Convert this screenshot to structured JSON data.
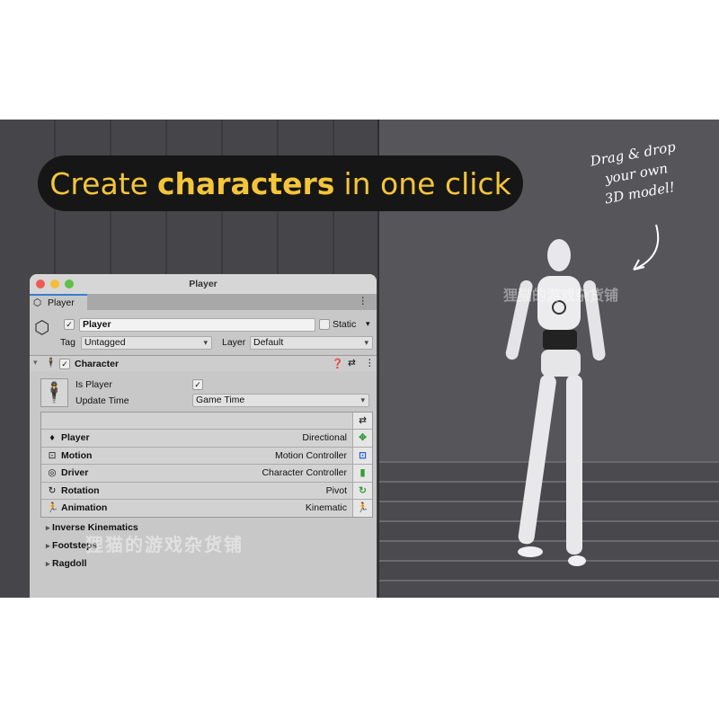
{
  "banner": {
    "prefix": "Create",
    "bold": "characters",
    "suffix": "in one click"
  },
  "annotation": {
    "line1": "Drag & drop",
    "line2": "your own",
    "line3": "3D model!"
  },
  "watermark": "狸猫的游戏杂货铺",
  "window": {
    "title": "Player",
    "tab": "Player",
    "object": {
      "name": "Player",
      "active": true,
      "static_label": "Static",
      "static": false,
      "tag_label": "Tag",
      "tag": "Untagged",
      "layer_label": "Layer",
      "layer": "Default"
    },
    "component": {
      "name": "Character",
      "enabled": true,
      "is_player_label": "Is Player",
      "is_player": true,
      "update_time_label": "Update Time",
      "update_time": "Game Time"
    },
    "kernel": [
      {
        "icon": "diamond-icon",
        "icon_char": "♦",
        "name": "Player",
        "value": "Directional",
        "right_icon_char": "✥",
        "color": "#3a9a3a"
      },
      {
        "icon": "chip-icon",
        "icon_char": "⊡",
        "name": "Motion",
        "value": "Motion Controller",
        "right_icon_char": "⊡",
        "color": "#2a66d0"
      },
      {
        "icon": "wheel-icon",
        "icon_char": "◎",
        "name": "Driver",
        "value": "Character Controller",
        "right_icon_char": "▮",
        "color": "#3a9a3a"
      },
      {
        "icon": "rotate-icon",
        "icon_char": "↻",
        "name": "Rotation",
        "value": "Pivot",
        "right_icon_char": "↻",
        "color": "#3a9a3a"
      },
      {
        "icon": "running-icon",
        "icon_char": "🏃",
        "name": "Animation",
        "value": "Kinematic",
        "right_icon_char": "🏃",
        "color": "#3a9a3a"
      }
    ],
    "sections": [
      "Inverse Kinematics",
      "Footsteps",
      "Ragdoll"
    ]
  }
}
